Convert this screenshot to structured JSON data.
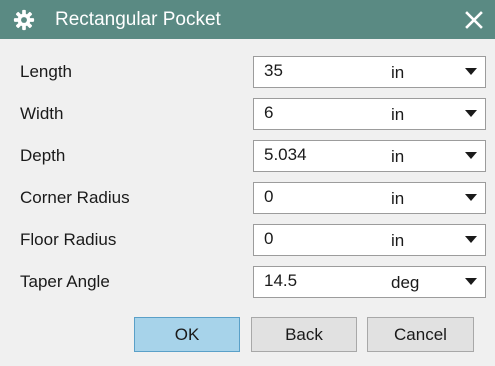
{
  "window": {
    "title": "Rectangular Pocket",
    "titlebar_color": "#5a8a83",
    "icon": "gear-icon",
    "close_icon": "close-icon"
  },
  "fields": [
    {
      "label": "Length",
      "value": "35",
      "unit": "in"
    },
    {
      "label": "Width",
      "value": "6",
      "unit": "in"
    },
    {
      "label": "Depth",
      "value": "5.034",
      "unit": "in"
    },
    {
      "label": "Corner Radius",
      "value": "0",
      "unit": "in"
    },
    {
      "label": "Floor Radius",
      "value": "0",
      "unit": "in"
    },
    {
      "label": "Taper Angle",
      "value": "14.5",
      "unit": "deg"
    }
  ],
  "buttons": {
    "ok": "OK",
    "back": "Back",
    "cancel": "Cancel",
    "ok_color": "#a7d3ea"
  }
}
